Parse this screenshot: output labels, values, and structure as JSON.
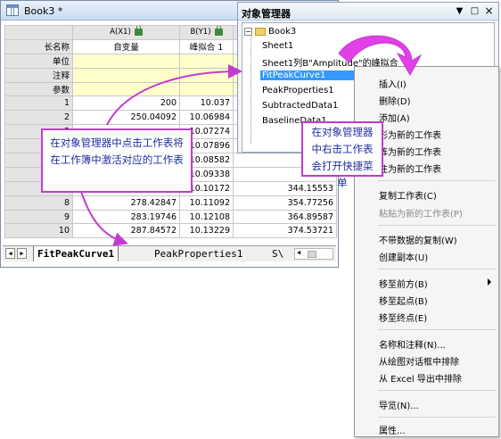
{
  "book": {
    "title": "Book3 *",
    "columns": [
      {
        "designation": "A(X1)",
        "long_name": "自变量"
      },
      {
        "designation": "B(Y1)",
        "long_name": "峰拟合 1"
      }
    ],
    "meta_rows": [
      "长名称",
      "单位",
      "注释",
      "参数"
    ],
    "rows": [
      {
        "n": "1",
        "a": "200",
        "b": "10.037",
        "c": ""
      },
      {
        "n": "2",
        "a": "250.04092",
        "b": "10.06984",
        "c": ""
      },
      {
        "n": "3",
        "a": "",
        "b": "10.07274",
        "c": ""
      },
      {
        "n": "4",
        "a": "",
        "b": "10.07896",
        "c": ""
      },
      {
        "n": "5",
        "a": "",
        "b": "10.08582",
        "c": "3"
      },
      {
        "n": "6",
        "a": "",
        "b": "10.09338",
        "c": "3"
      },
      {
        "n": "7",
        "a": "",
        "b": "10.10172",
        "c": "344.15553"
      },
      {
        "n": "8",
        "a": "278.42847",
        "b": "10.11092",
        "c": "354.77256"
      },
      {
        "n": "9",
        "a": "283.19746",
        "b": "10.12108",
        "c": "364.89587"
      },
      {
        "n": "10",
        "a": "287.84572",
        "b": "10.13229",
        "c": "374.53721"
      }
    ],
    "tabs": [
      "FitPeakCurve1",
      "PeakProperties1",
      "S\\"
    ]
  },
  "object_manager": {
    "title": "对象管理器",
    "pin_glyph": "▼",
    "restore_glyph": "□",
    "close_glyph": "×",
    "tree": [
      {
        "label": "Book3",
        "level": 0
      },
      {
        "label": "Sheet1",
        "level": 1
      },
      {
        "label": "Sheet1列B\"Amplitude\"的峰拟合",
        "level": 1
      },
      {
        "label": "FitPeakCurve1",
        "level": 1,
        "selected": true
      },
      {
        "label": "PeakProperties1",
        "level": 1
      },
      {
        "label": "SubtractedData1",
        "level": 1
      },
      {
        "label": "BaselineData1",
        "level": 1
      }
    ]
  },
  "context_menu": {
    "items": [
      {
        "label": "插入(I)",
        "disabled": false
      },
      {
        "label": "删除(D)",
        "disabled": false
      },
      {
        "label": "添加(A)",
        "disabled": false
      },
      {
        "label": "形为新的工作表",
        "disabled": false
      },
      {
        "label": "阵为新的工作表",
        "disabled": false
      },
      {
        "label": "注为新的工作表",
        "disabled": false
      },
      {
        "label": "复制工作表(C)",
        "disabled": false
      },
      {
        "label": "粘贴为新的工作表(P)",
        "disabled": true
      },
      {
        "label": "不带数据的复制(W)",
        "disabled": false
      },
      {
        "label": "创建副本(U)",
        "disabled": false
      },
      {
        "label": "移至前方(B)",
        "disabled": false,
        "submenu": true
      },
      {
        "label": "移至起点(B)",
        "disabled": false
      },
      {
        "label": "移至终点(E)",
        "disabled": false
      },
      {
        "label": "名称和注释(N)...",
        "disabled": false
      },
      {
        "label": "从绘图对话框中排除",
        "disabled": false
      },
      {
        "label": "从 Excel 导出中排除",
        "disabled": false
      },
      {
        "label": "导览(N)...",
        "disabled": false
      },
      {
        "label": "属性...",
        "disabled": false
      }
    ]
  },
  "callouts": {
    "left": "在对象管理器中点击工作表将在工作簿中激活对应的工作表",
    "right": "在对象管理器中右击工作表会打开快捷菜单"
  },
  "colors": {
    "accent_magenta": "#c23bcf",
    "selection_blue": "#3399ff",
    "meta_row_yellow": "#ffffcc"
  }
}
